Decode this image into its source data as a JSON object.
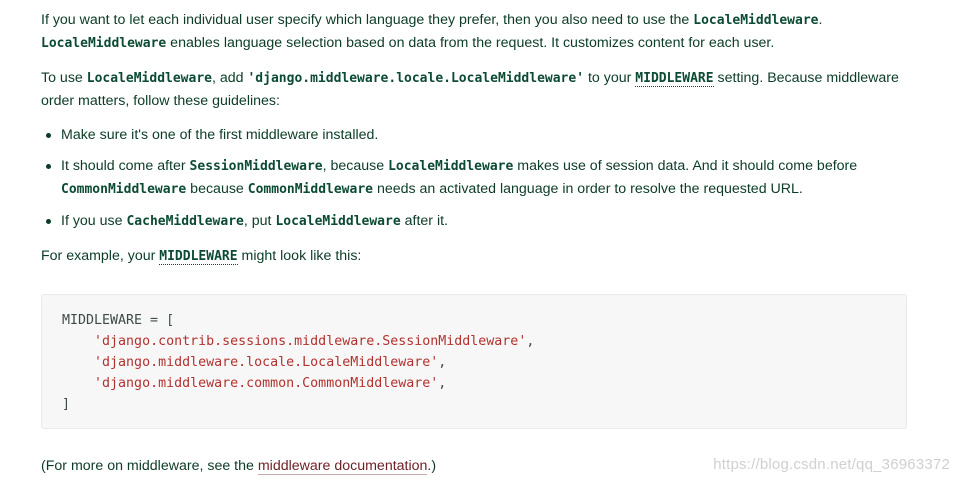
{
  "paragraph1": {
    "t1": "If you want to let each individual user specify which language they prefer, then you also need to use the ",
    "c1": "LocaleMiddleware",
    "t2": ".",
    "c2": "LocaleMiddleware",
    "t3": " enables language selection based on data from the request. It customizes content for each user."
  },
  "paragraph2": {
    "t1": "To use ",
    "c1": "LocaleMiddleware",
    "t2": ", add ",
    "c2": "'django.middleware.locale.LocaleMiddleware'",
    "t3": " to your ",
    "link": "MIDDLEWARE",
    "t4": " setting. Because middleware order matters, follow these guidelines:"
  },
  "bullets": {
    "b1": {
      "t1": "Make sure it's one of the first middleware installed."
    },
    "b2": {
      "t1": "It should come after ",
      "c1": "SessionMiddleware",
      "t2": ", because ",
      "c2": "LocaleMiddleware",
      "t3": " makes use of session data. And it should come before ",
      "c3": "CommonMiddleware",
      "t4": " because ",
      "c4": "CommonMiddleware",
      "t5": " needs an activated language in order to resolve the requested URL."
    },
    "b3": {
      "t1": "If you use ",
      "c1": "CacheMiddleware",
      "t2": ", put ",
      "c2": "LocaleMiddleware",
      "t3": " after it."
    }
  },
  "paragraph3": {
    "t1": "For example, your ",
    "link": "MIDDLEWARE",
    "t2": " might look like this:"
  },
  "code": {
    "l1": "MIDDLEWARE = [",
    "l2_indent": "    ",
    "l2": "'django.contrib.sessions.middleware.SessionMiddleware'",
    "l2_tail": ",",
    "l3_indent": "    ",
    "l3": "'django.middleware.locale.LocaleMiddleware'",
    "l3_tail": ",",
    "l4_indent": "    ",
    "l4": "'django.middleware.common.CommonMiddleware'",
    "l4_tail": ",",
    "l5": "]"
  },
  "paragraph4": {
    "t1": "(For more on middleware, see the ",
    "link": "middleware documentation",
    "t2": ".)"
  },
  "watermark": "https://blog.csdn.net/qq_36963372"
}
